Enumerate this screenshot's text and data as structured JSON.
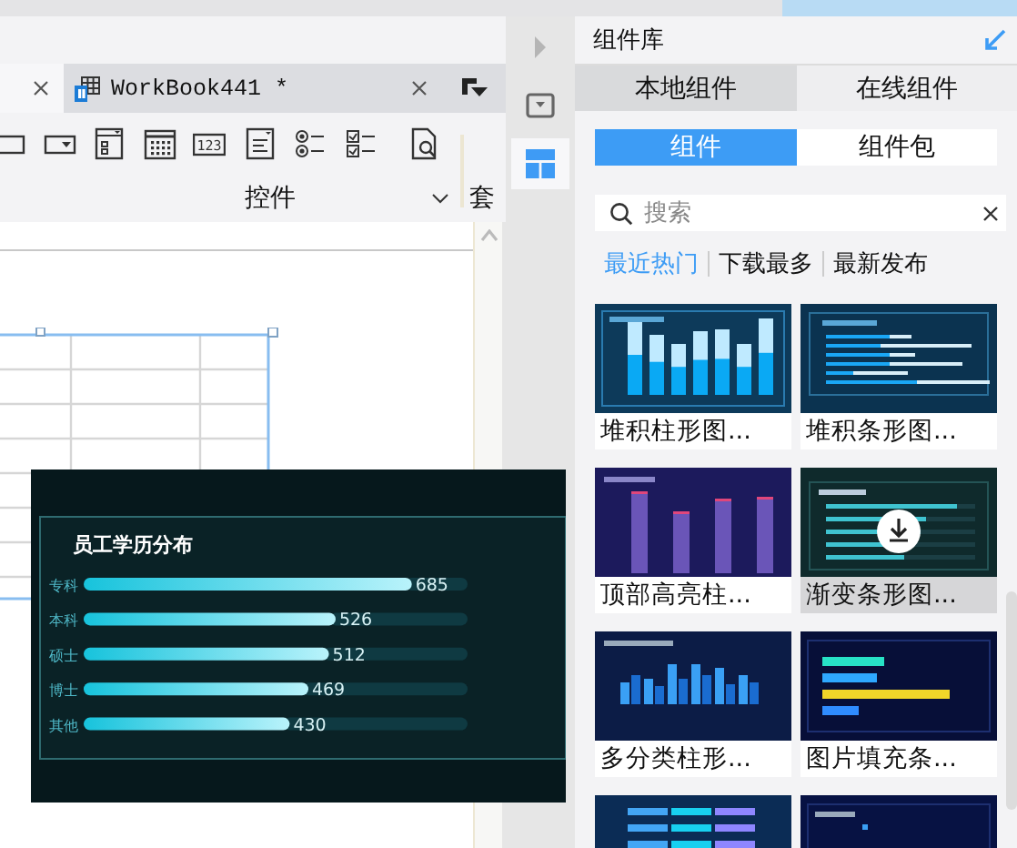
{
  "editor_tabs": [
    {
      "selected": true
    },
    {
      "label": "WorkBook441 *",
      "selected": false
    }
  ],
  "toolbar": {
    "icons": [
      {
        "kind": "button"
      },
      {
        "kind": "combo"
      },
      {
        "kind": "panel"
      },
      {
        "kind": "calendar"
      },
      {
        "kind": "number",
        "text": "123"
      },
      {
        "kind": "textarea"
      },
      {
        "kind": "radio"
      },
      {
        "kind": "checkbox"
      },
      {
        "kind": "preview"
      }
    ],
    "group_label": "控件",
    "next_group_label": "套"
  },
  "side_tools": [
    {
      "kind": "expand",
      "selected": false
    },
    {
      "kind": "dropdown",
      "selected": false
    },
    {
      "kind": "layout",
      "selected": true
    }
  ],
  "library": {
    "title": "组件库",
    "tabs": [
      {
        "label": "本地组件",
        "selected": true
      },
      {
        "label": "在线组件",
        "selected": false
      }
    ],
    "modes": [
      {
        "label": "组件",
        "selected": true
      },
      {
        "label": "组件包",
        "selected": false
      }
    ],
    "search": {
      "placeholder": "搜索"
    },
    "filters": [
      {
        "label": "最近热门",
        "selected": true
      },
      {
        "label": "下载最多",
        "selected": false
      },
      {
        "label": "最新发布",
        "selected": false
      }
    ],
    "cards": [
      {
        "kind": "stacked-column",
        "title": "堆积柱形图...",
        "hovered": false
      },
      {
        "kind": "stacked-bar",
        "title": "堆积条形图...",
        "hovered": false
      },
      {
        "kind": "highlight-column",
        "title": "顶部高亮柱...",
        "hovered": false
      },
      {
        "kind": "gradient-bar",
        "title": "渐变条形图...",
        "hovered": true
      },
      {
        "kind": "grouped-column",
        "title": "多分类柱形...",
        "hovered": false
      },
      {
        "kind": "pictorial-bar",
        "title": "图片填充条...",
        "hovered": false
      },
      {
        "kind": "table"
      },
      {
        "kind": "combo"
      }
    ]
  },
  "preview": {
    "chart_data": {
      "type": "bar",
      "orientation": "horizontal",
      "title": "员工学历分布",
      "categories": [
        "专科",
        "本科",
        "硕士",
        "博士",
        "其他"
      ],
      "values": [
        685,
        526,
        512,
        469,
        430
      ],
      "data_labels": true
    }
  }
}
